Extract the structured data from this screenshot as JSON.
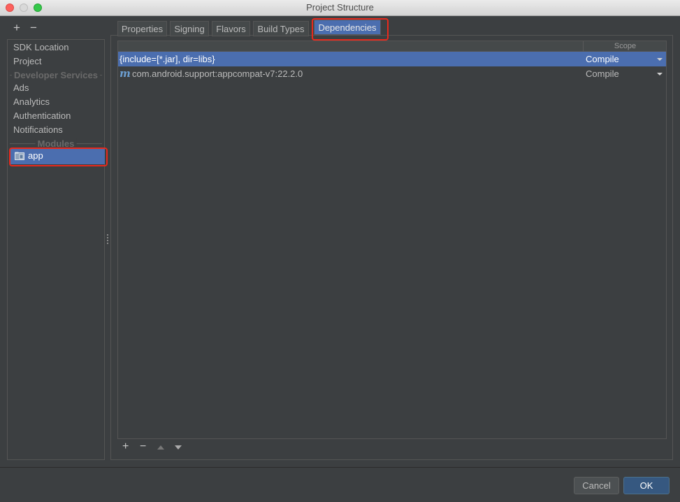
{
  "window": {
    "title": "Project Structure"
  },
  "left_toolbar": {
    "add": "+",
    "remove": "−"
  },
  "sidebar": {
    "items": [
      {
        "label": "SDK Location"
      },
      {
        "label": "Project"
      }
    ],
    "developer_services_header": "Developer Services",
    "developer_services": [
      {
        "label": "Ads"
      },
      {
        "label": "Analytics"
      },
      {
        "label": "Authentication"
      },
      {
        "label": "Notifications"
      }
    ],
    "modules_header": "Modules",
    "modules": [
      {
        "label": "app",
        "icon": "module-folder-icon",
        "selected": true
      }
    ]
  },
  "tabs": [
    {
      "label": "Properties"
    },
    {
      "label": "Signing"
    },
    {
      "label": "Flavors"
    },
    {
      "label": "Build Types"
    },
    {
      "label": "Dependencies",
      "active": true
    }
  ],
  "dependencies": {
    "scope_header": "Scope",
    "rows": [
      {
        "name": "{include=[*.jar], dir=libs}",
        "scope": "Compile",
        "selected": true
      },
      {
        "icon_glyph": "m",
        "name": "com.android.support:appcompat-v7:22.2.0",
        "scope": "Compile",
        "selected": false
      }
    ],
    "toolbar": {
      "add": "+",
      "remove": "−"
    }
  },
  "footer": {
    "cancel_label": "Cancel",
    "ok_label": "OK"
  },
  "colors": {
    "background": "#3c3f41",
    "selection": "#4b6eaf",
    "highlight_border": "#e8291c",
    "ok_button": "#365880"
  }
}
